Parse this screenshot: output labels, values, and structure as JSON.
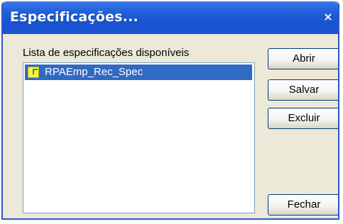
{
  "window": {
    "title": "Especificações...",
    "close_glyph": "×"
  },
  "list": {
    "label": "Lista de especificações disponíveis",
    "items": [
      {
        "label": "RPAEmp_Rec_Spec",
        "icon": "spec-file-icon",
        "selected": true
      }
    ]
  },
  "buttons": {
    "open": "Abrir",
    "save": "Salvar",
    "delete": "Excluir",
    "close": "Fechar"
  },
  "colors": {
    "titlebar": "#1f5ed8",
    "selection": "#316ac5",
    "dialog_background": "#ece9d8"
  }
}
